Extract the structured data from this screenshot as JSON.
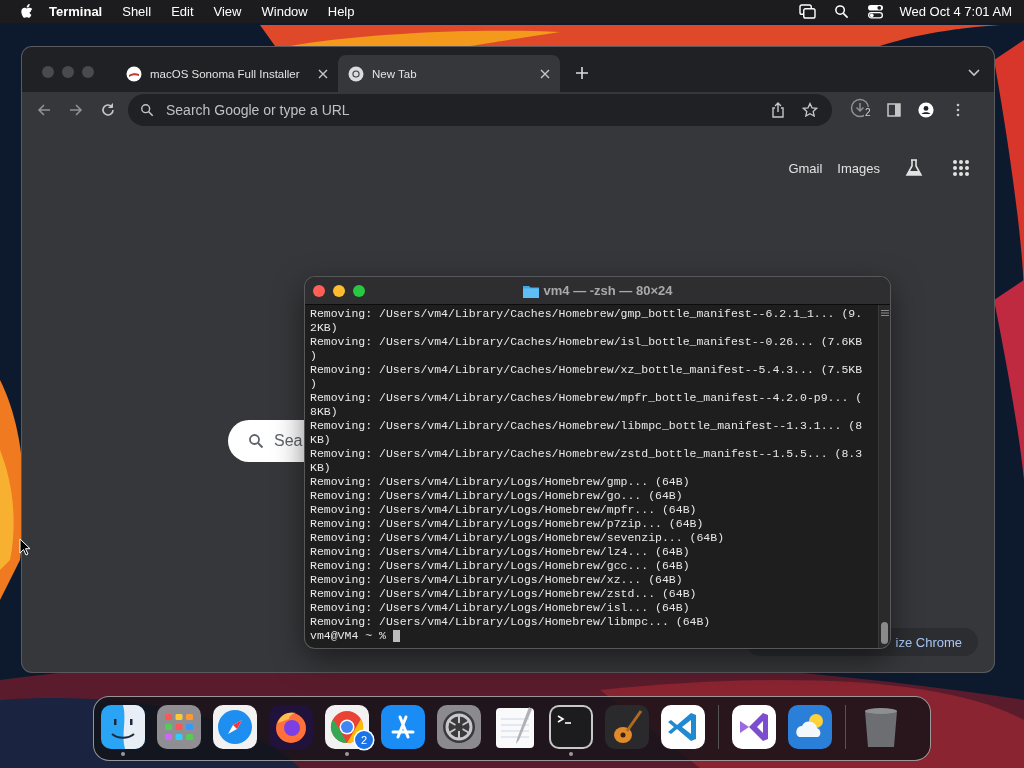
{
  "menu_bar": {
    "app_name": "Terminal",
    "menus": [
      "Shell",
      "Edit",
      "View",
      "Window",
      "Help"
    ],
    "clock": "Wed Oct 4  7:01 AM"
  },
  "browser": {
    "tabs": [
      {
        "title": "macOS Sonoma Full Installer",
        "selected": false,
        "kind": "site"
      },
      {
        "title": "New Tab",
        "selected": true,
        "kind": "chrome"
      }
    ],
    "address_placeholder": "Search Google or type a URL",
    "downloads_badge": "2",
    "header_links": [
      "Gmail",
      "Images"
    ],
    "search_placeholder": "Sea",
    "customize_button": "ize Chrome"
  },
  "terminal": {
    "title": "vm4 — -zsh — 80×24",
    "lines": [
      "Removing: /Users/vm4/Library/Caches/Homebrew/gmp_bottle_manifest--6.2.1_1... (9.",
      "2KB)",
      "Removing: /Users/vm4/Library/Caches/Homebrew/isl_bottle_manifest--0.26... (7.6KB",
      ")",
      "Removing: /Users/vm4/Library/Caches/Homebrew/xz_bottle_manifest--5.4.3... (7.5KB",
      ")",
      "Removing: /Users/vm4/Library/Caches/Homebrew/mpfr_bottle_manifest--4.2.0-p9... (",
      "8KB)",
      "Removing: /Users/vm4/Library/Caches/Homebrew/libmpc_bottle_manifest--1.3.1... (8",
      "KB)",
      "Removing: /Users/vm4/Library/Caches/Homebrew/zstd_bottle_manifest--1.5.5... (8.3",
      "KB)",
      "Removing: /Users/vm4/Library/Logs/Homebrew/gmp... (64B)",
      "Removing: /Users/vm4/Library/Logs/Homebrew/go... (64B)",
      "Removing: /Users/vm4/Library/Logs/Homebrew/mpfr... (64B)",
      "Removing: /Users/vm4/Library/Logs/Homebrew/p7zip... (64B)",
      "Removing: /Users/vm4/Library/Logs/Homebrew/sevenzip... (64B)",
      "Removing: /Users/vm4/Library/Logs/Homebrew/lz4... (64B)",
      "Removing: /Users/vm4/Library/Logs/Homebrew/gcc... (64B)",
      "Removing: /Users/vm4/Library/Logs/Homebrew/xz... (64B)",
      "Removing: /Users/vm4/Library/Logs/Homebrew/zstd... (64B)",
      "Removing: /Users/vm4/Library/Logs/Homebrew/isl... (64B)",
      "Removing: /Users/vm4/Library/Logs/Homebrew/libmpc... (64B)"
    ],
    "prompt": "vm4@VM4 ~ % "
  },
  "dock": {
    "items": [
      {
        "kind": "finder",
        "running": true
      },
      {
        "kind": "launchpad",
        "running": false
      },
      {
        "kind": "safari",
        "running": false
      },
      {
        "kind": "firefox",
        "running": false
      },
      {
        "kind": "chrome",
        "running": true,
        "badge": "2"
      },
      {
        "kind": "appstore",
        "running": false
      },
      {
        "kind": "settings",
        "running": false
      },
      {
        "kind": "textedit",
        "running": false
      },
      {
        "kind": "terminal",
        "running": true
      },
      {
        "kind": "garageband",
        "running": false
      },
      {
        "kind": "vscode",
        "running": false
      },
      {
        "kind": "separator"
      },
      {
        "kind": "visualstudio",
        "running": false
      },
      {
        "kind": "weather",
        "running": false
      },
      {
        "kind": "separator"
      },
      {
        "kind": "trash",
        "running": false
      }
    ]
  }
}
